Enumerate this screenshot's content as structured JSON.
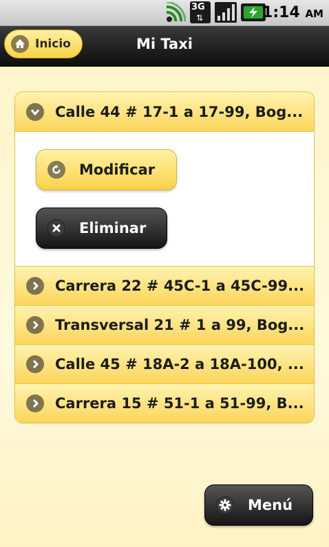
{
  "status_bar": {
    "time": "1:14",
    "ampm": "AM",
    "network_label": "3G",
    "icons": [
      "wifi-signal-icon",
      "network-3g-icon",
      "cell-signal-icon",
      "battery-charging-icon"
    ]
  },
  "header": {
    "home_label": "Inicio",
    "home_icon": "home-icon",
    "title": "Mi Taxi"
  },
  "addresses": {
    "expanded": {
      "label": "Calle 44 # 17-1 a 17-99, Bog...",
      "icon": "chevron-down-icon",
      "actions": {
        "modify_label": "Modificar",
        "modify_icon": "refresh-icon",
        "delete_label": "Eliminar",
        "delete_icon": "close-icon"
      }
    },
    "items": [
      {
        "label": "Carrera 22 # 45C-1 a 45C-99...",
        "icon": "chevron-right-icon"
      },
      {
        "label": "Transversal 21 # 1 a 99, Bog...",
        "icon": "chevron-right-icon"
      },
      {
        "label": "Calle 45 # 18A-2 a 18A-100, ...",
        "icon": "chevron-right-icon"
      },
      {
        "label": "Carrera 15 # 51-1 a 51-99, B...",
        "icon": "chevron-right-icon"
      }
    ]
  },
  "menu": {
    "label": "Menú",
    "icon": "gear-icon"
  },
  "colors": {
    "accent_yellow": "#fbd55a",
    "background": "#fff7cf",
    "header": "#1a1a1a"
  }
}
